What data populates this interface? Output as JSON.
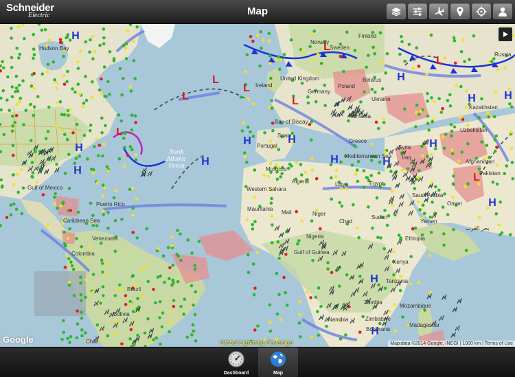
{
  "header": {
    "brand_name": "Schneider",
    "brand_sub": "Electric",
    "title": "Map",
    "tools": [
      {
        "icon": "layers-icon"
      },
      {
        "icon": "sliders-icon"
      },
      {
        "icon": "airplane-icon"
      },
      {
        "icon": "location-pin-icon"
      },
      {
        "icon": "crosshair-icon"
      },
      {
        "icon": "user-icon"
      }
    ]
  },
  "map": {
    "place_labels": {
      "hudson_bay": "Hudson Bay",
      "gulf_of_mexico": "Gulf of Mexico",
      "caribbean_sea": "Caribbean Sea",
      "venezuela": "Venezuela",
      "colombia": "Colombia",
      "brazil": "Brazil",
      "bolivia": "Bolivia",
      "chile": "Chile",
      "puerto_rico": "Puerto Rico",
      "north_atlantic_ocean": "North Atlantic Ocean",
      "finland": "Finland",
      "norway": "Norway",
      "united_kingdom": "United Kingdom",
      "ireland": "Ireland",
      "germany": "Germany",
      "poland": "Poland",
      "belarus": "Belarus",
      "ukraine": "Ukraine",
      "romania": "Romania",
      "bay_of_biscay": "Bay of Biscay",
      "portugal": "Portugal",
      "spain": "Spain",
      "greece": "Greece",
      "mediterranean_sea": "Mediterranean Sea",
      "morocco": "Morocco",
      "algeria": "Algeria",
      "libya": "Libya",
      "egypt": "Egypt",
      "western_sahara": "Western Sahara",
      "mauritania": "Mauritania",
      "mali": "Mali",
      "niger": "Niger",
      "chad": "Chad",
      "sudan": "Sudan",
      "nigeria": "Nigeria",
      "gulf_of_guinea": "Gulf of Guinea",
      "ethiopia": "Ethiopia",
      "kenya": "Kenya",
      "tanzania": "Tanzania",
      "zambia": "Zambia",
      "namibia": "Namibia",
      "botswana": "Botswana",
      "zimbabwe": "Zimbabwe",
      "mozambique": "Mozambique",
      "madagascar": "Madagascar",
      "saudi_arabia": "Saudi Arabia",
      "yemen": "Yemen",
      "oman": "Oman",
      "iraq": "Iraq",
      "syria": "Syria",
      "uzbekistan": "Uzbekistan",
      "kazakhstan": "Kazakhstan",
      "afghanistan": "Afghanistan",
      "pakistan": "Pakistan",
      "arabian_sea_ar": "بحر العرب",
      "sweden": "Sweden",
      "russia_partial": "Russia"
    },
    "pressure_markers": [
      {
        "label": "H",
        "color": "#1a33d6"
      },
      {
        "label": "L",
        "color": "#d61a1a"
      }
    ],
    "google_logo": "Google",
    "credits": "Map data ©2014 Google, INEGI  |  1000 km  |  Terms of Use",
    "coverage_label": "Global Lightning Coverage"
  },
  "bottom_nav": {
    "tabs": [
      {
        "label": "Dashboard",
        "icon": "gauge-icon",
        "active": false
      },
      {
        "label": "Map",
        "icon": "globe-icon",
        "active": true
      }
    ]
  },
  "colors": {
    "land": "#e9e4cf",
    "green_land": "#c6d9a4",
    "ocean": "#a8c7d9",
    "high_pressure": "#1a33d6",
    "low_pressure": "#d61a1a",
    "warning_zone": "#e58f8f",
    "lightning_marker": "#2cc8c8",
    "station_green": "#2fb52f",
    "station_yellow": "#f2e02a",
    "station_red": "#e02020"
  }
}
